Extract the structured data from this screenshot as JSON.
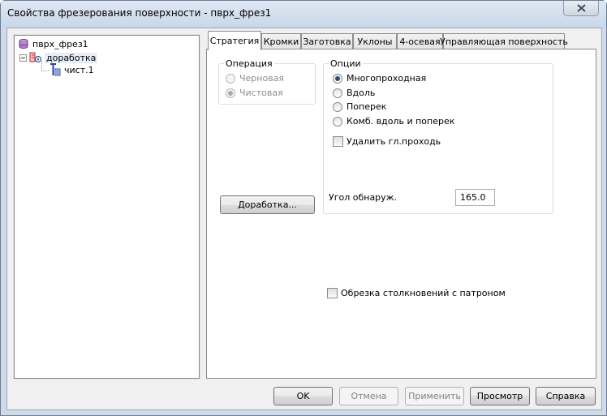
{
  "window": {
    "title": "Свойства фрезерования поверхности - пврх_фрез1"
  },
  "tree": {
    "root_label": "пврх_фрез1",
    "child_label": "доработка",
    "leaf_label": "чист.1"
  },
  "tabs": [
    {
      "label": "Стратегия"
    },
    {
      "label": "Кромки"
    },
    {
      "label": "Заготовка"
    },
    {
      "label": "Уклоны"
    },
    {
      "label": "4-осевая"
    },
    {
      "label": "Управляющая поверхность"
    }
  ],
  "operation": {
    "legend": "Операция",
    "rough_label": "Черновая",
    "finish_label": "Чистовая"
  },
  "options": {
    "legend": "Опции",
    "multipass_label": "Многопроходная",
    "along_label": "Вдоль",
    "across_label": "Поперек",
    "combo_label": "Комб. вдоль и поперек",
    "remove_pass_label": "Удалить гл.проходь",
    "angle_label": "Угол обнаруж.",
    "angle_value": "165.0"
  },
  "rework_button": "Доработка...",
  "collision_label": "Обрезка столкновений с патроном",
  "buttons": {
    "ok": "OK",
    "cancel": "Отмена",
    "apply": "Применить",
    "preview": "Просмотр",
    "help": "Справка"
  }
}
